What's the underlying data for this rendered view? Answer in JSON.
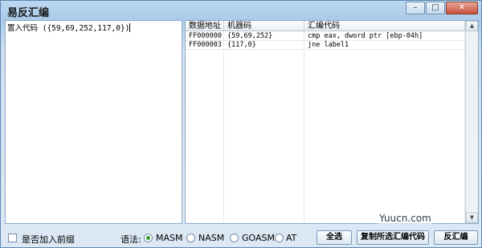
{
  "window": {
    "title": "易反汇编",
    "minimize_glyph": "–",
    "maximize_glyph": "□",
    "close_glyph": "✕"
  },
  "input": {
    "text": "置入代码 ({59,69,252,117,0})"
  },
  "table": {
    "columns": [
      "数据地址",
      "机器码",
      "汇编代码"
    ],
    "rows": [
      {
        "address": "FF000000",
        "machine_code": "{59,69,252}",
        "asm": "cmp eax, dword ptr [ebp-04h]"
      },
      {
        "address": "FF000003",
        "machine_code": "{117,0}",
        "asm": "jne label1"
      }
    ]
  },
  "bottom": {
    "prefix_checkbox_label": "是否加入前缀",
    "prefix_checked": false,
    "syntax_label": "语法:",
    "syntax_options": [
      "MASM",
      "NASM",
      "GOASM",
      "AT"
    ],
    "syntax_selected": "MASM",
    "select_all_label": "全选",
    "copy_label": "复制所选汇编代码",
    "disassemble_label": "反汇编"
  },
  "watermark": "Yuucn.com",
  "colors": {
    "radio_selected": "#3a9a2e",
    "border": "#8fa9c4"
  }
}
